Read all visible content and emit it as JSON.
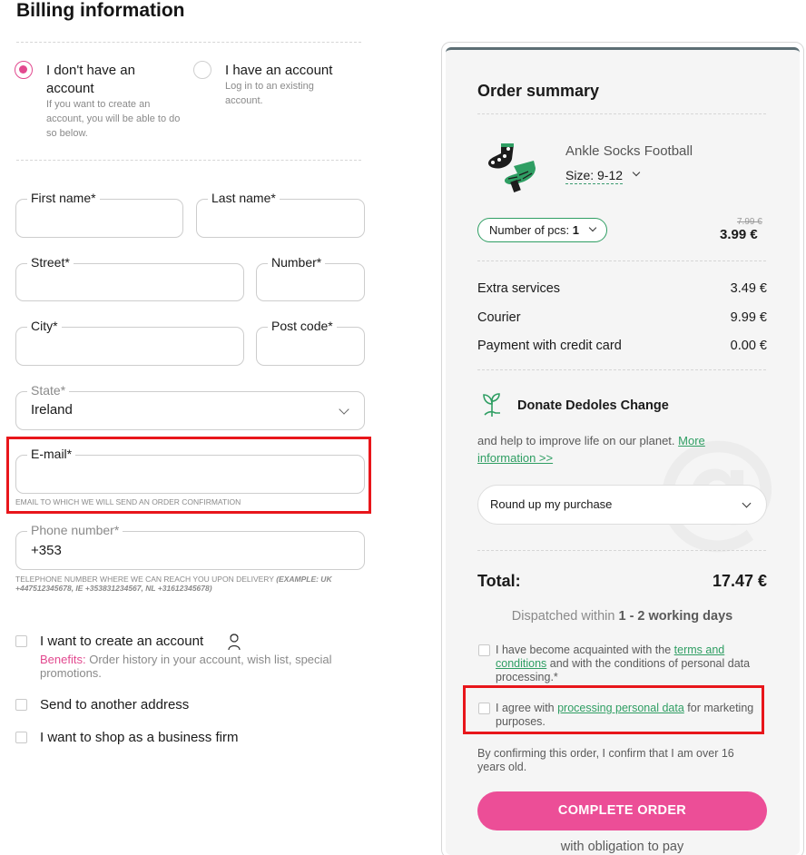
{
  "page_title": "Billing information",
  "account_choice": {
    "no_account": {
      "title": "I don't have an account",
      "subtitle": "If you want to create an account, you will be able to do so below.",
      "selected": true
    },
    "have_account": {
      "title": "I have an account",
      "subtitle": "Log in to an existing account.",
      "selected": false
    }
  },
  "form": {
    "first_name": {
      "label": "First name*",
      "value": ""
    },
    "last_name": {
      "label": "Last name*",
      "value": ""
    },
    "street": {
      "label": "Street*",
      "value": ""
    },
    "number": {
      "label": "Number*",
      "value": ""
    },
    "city": {
      "label": "City*",
      "value": ""
    },
    "post_code": {
      "label": "Post code*",
      "value": ""
    },
    "state": {
      "label": "State*",
      "value": "Ireland"
    },
    "email": {
      "label": "E-mail*",
      "value": "",
      "hint": "EMAIL TO WHICH WE WILL SEND AN ORDER CONFIRMATION"
    },
    "phone": {
      "label": "Phone number*",
      "value": "+353",
      "hint": "TELEPHONE NUMBER WHERE WE CAN REACH YOU UPON DELIVERY",
      "hint_example": "(EXAMPLE: UK +447512345678, IE +353831234567, NL +31612345678)"
    }
  },
  "options": {
    "create_account": {
      "label": "I want to create an account",
      "benefits_label": "Benefits:",
      "benefits_text": "Order history in your account, wish list, special promotions."
    },
    "another_address": {
      "label": "Send to another address"
    },
    "business": {
      "label": "I want to shop as a business firm"
    }
  },
  "summary": {
    "title": "Order summary",
    "product": {
      "name": "Ankle Socks Football",
      "size_label": "Size:",
      "size_value": "9-12",
      "qty_label": "Number of pcs:",
      "qty_value": "1",
      "old_price": "7.99 €",
      "price": "3.99 €"
    },
    "rows": [
      {
        "label": "Extra services",
        "value": "3.49 €"
      },
      {
        "label": "Courier",
        "value": "9.99 €"
      },
      {
        "label": "Payment with credit card",
        "value": "0.00 €"
      }
    ],
    "donate": {
      "title": "Donate Dedoles Change",
      "text": "and help to improve life on our planet.",
      "link": "More information >>",
      "roundup": "Round up my purchase"
    },
    "total_label": "Total:",
    "total_value": "17.47 €",
    "dispatch_prefix": "Dispatched within",
    "dispatch_days": "1 - 2 working days",
    "terms": {
      "prefix": "I have become acquainted with the",
      "link": "terms and conditions",
      "suffix": "and with the conditions of personal data processing.*"
    },
    "marketing": {
      "prefix": "I agree with",
      "link": "processing personal data",
      "suffix": "for marketing purposes."
    },
    "age_notice": "By confirming this order, I confirm that I am over 16 years old.",
    "complete_button": "COMPLETE ORDER",
    "obligation": "with obligation to pay"
  },
  "colors": {
    "accent_pink": "#ec4e97",
    "accent_green": "#2f9e63",
    "highlight_red": "#e8161b"
  }
}
